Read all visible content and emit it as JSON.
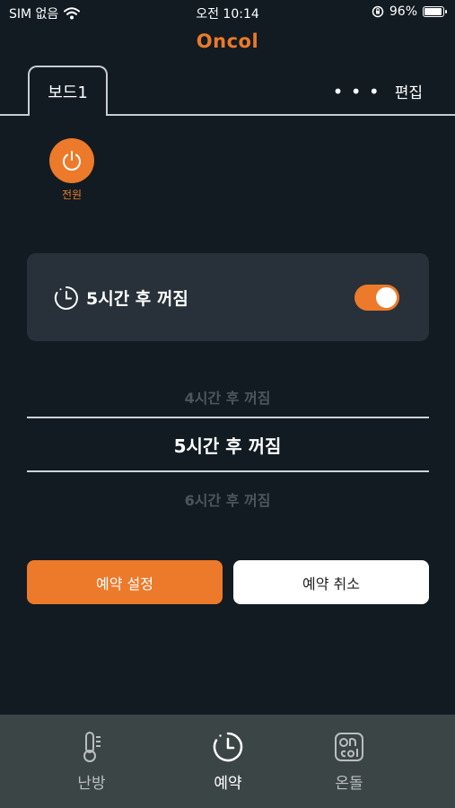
{
  "status": {
    "carrier": "SIM 없음",
    "time": "오전 10:14",
    "battery": "96%",
    "battery_level": 0.96
  },
  "header": {
    "logo": "Oncol"
  },
  "tabs": {
    "board": "보드1",
    "more": "• • •",
    "edit": "편집"
  },
  "power": {
    "label": "전원"
  },
  "timer_card": {
    "title": "5시간 후 꺼짐",
    "enabled": true
  },
  "picker": {
    "prev": "4시간 후 꺼짐",
    "selected": "5시간 후 꺼짐",
    "next": "6시간 후 꺼짐"
  },
  "actions": {
    "set_label": "예약 설정",
    "cancel_label": "예약 취소"
  },
  "bottom_nav": {
    "items": [
      {
        "label": "난방",
        "icon": "thermometer-icon",
        "active": false
      },
      {
        "label": "예약",
        "icon": "timer-icon",
        "active": true
      },
      {
        "label": "온돌",
        "icon": "oncol-logo-icon",
        "active": false
      }
    ]
  },
  "colors": {
    "background": "#121b22",
    "accent": "#ec7a2a",
    "card": "#283139",
    "nav": "#3c4545"
  }
}
